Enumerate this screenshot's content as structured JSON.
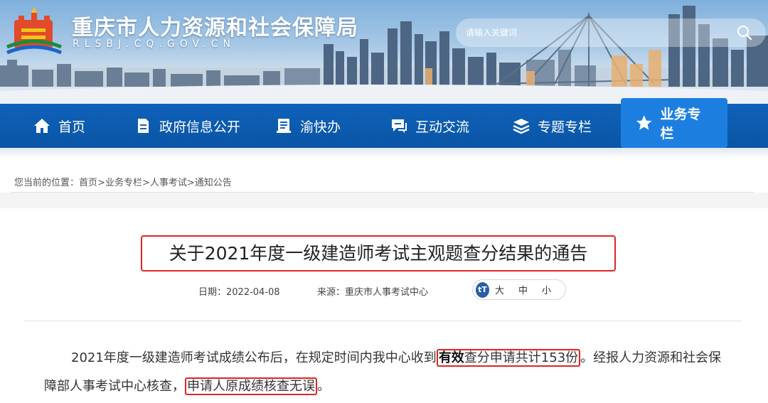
{
  "header": {
    "site_title": "重庆市人力资源和社会保障局",
    "site_domain": "RLSBJ.CQ.GOV.CN",
    "search_placeholder": "请输入关键词",
    "icons": [
      "logo-emblem",
      "search-icon"
    ]
  },
  "nav": {
    "items": [
      {
        "label": "首页",
        "icon": "home-icon"
      },
      {
        "label": "政府信息公开",
        "icon": "document-icon"
      },
      {
        "label": "渝快办",
        "icon": "book-icon"
      },
      {
        "label": "互动交流",
        "icon": "chat-icon"
      },
      {
        "label": "专题专栏",
        "icon": "layers-icon"
      },
      {
        "label": "业务专栏",
        "icon": "star-icon",
        "active": true
      }
    ],
    "active_color": "#1c7fe0",
    "bar_color": "#0f62b9"
  },
  "breadcrumb": {
    "prefix": "您当前的位置：",
    "items": [
      "首页",
      "业务专栏",
      "人事考试",
      "通知公告"
    ],
    "separator": ">"
  },
  "article": {
    "title": "关于2021年度一级建造师考试主观题查分结果的通告",
    "date_label": "日期：",
    "date": "2022-04-08",
    "source_label": "来源：",
    "source": "重庆市人事考试中心",
    "font_size": {
      "icon": "tT",
      "large": "大",
      "medium": "中",
      "small": "小"
    },
    "body": {
      "part1": "2021年度一级建造师考试成绩公布后，在规定时间内我中心收到",
      "hl1_bold": "有效",
      "hl1_rest": "查分申请共计153份",
      "part2": "。经报人力资源和社会保障部人事考试中心核查，",
      "hl2": "申请人原成绩核查无误",
      "part3": "。"
    },
    "highlight_color": "#e02424"
  }
}
